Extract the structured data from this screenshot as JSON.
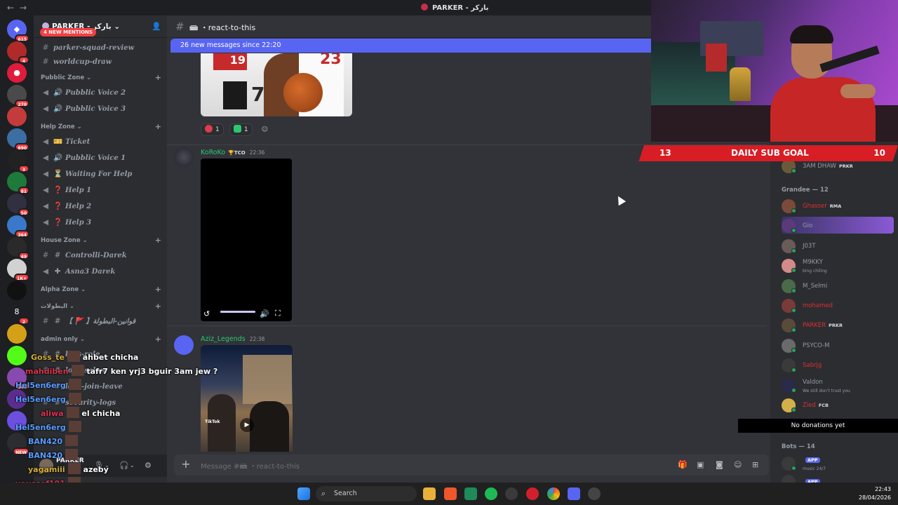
{
  "window": {
    "title": "PARKER - باركر"
  },
  "server": {
    "name": "PARKER - باركر"
  },
  "mentions_badge": "4 NEW MENTIONS",
  "channel_list": {
    "top_channels": [
      "parker-squad-review",
      "worldcup-draw"
    ],
    "categories": [
      {
        "name": "Pubblic Zone ⌄",
        "channels": [
          {
            "icon": "speaker-icon",
            "name": "Pubblic Voice 2"
          },
          {
            "icon": "speaker-icon",
            "name": "Pubblic Voice 3"
          }
        ]
      },
      {
        "name": "Help Zone ⌄",
        "channels": [
          {
            "icon": "ticket-icon",
            "name": "Ticket"
          },
          {
            "icon": "speaker-icon",
            "name": "Pubblic Voice 1"
          },
          {
            "icon": "hourglass-icon",
            "name": "Waiting For Help"
          },
          {
            "icon": "question-icon",
            "name": "Help 1"
          },
          {
            "icon": "question-icon",
            "name": "Help 2"
          },
          {
            "icon": "question-icon",
            "name": "Help 3"
          }
        ]
      },
      {
        "name": "House Zone ⌄",
        "channels": [
          {
            "icon": "hash-icon",
            "name": "Controlli-Darek"
          },
          {
            "icon": "plus-icon",
            "name": "Asna3 Darek"
          }
        ]
      },
      {
        "name": "Alpha Zone ⌄",
        "channels": []
      },
      {
        "name": "البطولات ⌄",
        "channels": [
          {
            "icon": "hash-icon",
            "name": "【 🚩 】قوانين-البطولة"
          }
        ]
      },
      {
        "name": "admin only ⌄",
        "channels": [
          {
            "icon": "hash-icon",
            "name": "logs-role"
          },
          {
            "icon": "hash-icon",
            "name": "logs-salon"
          },
          {
            "icon": "hash-icon",
            "name": "logs-join-leave"
          },
          {
            "icon": "hash-icon",
            "name": "security-logs"
          }
        ]
      }
    ]
  },
  "guild_badges": [
    "615",
    "4",
    "",
    "270",
    "",
    "690",
    "3",
    "81",
    "50",
    "364",
    "49",
    "1K+",
    "",
    "2",
    "",
    "",
    "148",
    "",
    "",
    "NEW"
  ],
  "user_panel": {
    "name": "PARKER"
  },
  "chat": {
    "channel": "react-to-this",
    "new_messages_bar": "26 new messages since 22:20",
    "reactions": [
      {
        "emoji": "heart",
        "count": "1"
      },
      {
        "emoji": "check",
        "count": "1"
      }
    ],
    "messages": [
      {
        "author": "KoRoKo",
        "tag": "TCO",
        "time": "22:36"
      },
      {
        "author": "Aziz_Legends",
        "tag": "",
        "time": "22:38"
      }
    ],
    "image_text": {
      "n23": "23",
      "n74": "74",
      "n19": "19",
      "tiktok": "TikTok"
    },
    "composer_placeholder": "Message #📾 ・react-to-this"
  },
  "members": {
    "top_member": {
      "name": "3AM DHAW",
      "tag": "PRKR"
    },
    "grandee_header": "Grandee — 12",
    "grandee": [
      {
        "name": "Ghasser",
        "tag": "RMA",
        "color": "#e02f2f",
        "sub": ""
      },
      {
        "name": "Gio",
        "tag": "",
        "color": "#949ba4",
        "sub": ""
      },
      {
        "name": "J03T",
        "tag": "",
        "color": "#949ba4",
        "sub": ""
      },
      {
        "name": "M9KKY",
        "tag": "",
        "color": "#949ba4",
        "sub": "bing chiling"
      },
      {
        "name": "M_Selmi",
        "tag": "",
        "color": "#949ba4",
        "sub": ""
      },
      {
        "name": "mohamed",
        "tag": "",
        "color": "#e02f2f",
        "sub": ""
      },
      {
        "name": "PARKER",
        "tag": "PRKR",
        "color": "#e02f2f",
        "sub": ""
      },
      {
        "name": "PSYCO-M",
        "tag": "",
        "color": "#949ba4",
        "sub": ""
      },
      {
        "name": "Sabrjg",
        "tag": "",
        "color": "#e02f2f",
        "sub": ""
      },
      {
        "name": "Valdon",
        "tag": "",
        "color": "#949ba4",
        "sub": "We still don't trust you"
      },
      {
        "name": "Zied",
        "tag": "FCB",
        "color": "#e02f2f",
        "sub": ""
      }
    ],
    "bots_header": "Bots — 14",
    "bots": [
      {
        "name": "",
        "tag": "APP",
        "sub": "music 24/7"
      },
      {
        "name": "",
        "tag": "APP",
        "sub": ""
      }
    ]
  },
  "stream": {
    "sub_goal_left": "13",
    "sub_goal_label": "DAILY SUB GOAL",
    "sub_goal_right": "10",
    "donations": "No donations yet",
    "overlay_chat": [
      {
        "user": "Goss_te",
        "text": "ahbet chicha",
        "user_color": "#d4af37"
      },
      {
        "user": "mahdiben",
        "text": "tafr7 ken yrj3 bguir 3am jew ?",
        "user_color": "#d8344f"
      },
      {
        "user": "Hel5en6erg",
        "text": "",
        "user_color": "#5b9cff"
      },
      {
        "user": "Hel5en6erg",
        "text": "",
        "user_color": "#5b9cff"
      },
      {
        "user": "aliwa",
        "text": "el chicha",
        "user_color": "#d8344f"
      },
      {
        "user": "Hel5en6erg",
        "text": "",
        "user_color": "#5b9cff"
      },
      {
        "user": "BAN420",
        "text": "",
        "user_color": "#5b9cff"
      },
      {
        "user": "BAN420",
        "text": "",
        "user_color": "#5b9cff"
      },
      {
        "user": "yagamiii",
        "text": "azeby",
        "user_color": "#d4af37"
      },
      {
        "user": "youssef101",
        "text": "",
        "user_color": "#d8344f"
      },
      {
        "user": "youssef101",
        "text": "",
        "user_color": "#d8344f"
      }
    ]
  },
  "taskbar": {
    "search": "Search",
    "time": "22:43",
    "date": "28/04/2026"
  }
}
